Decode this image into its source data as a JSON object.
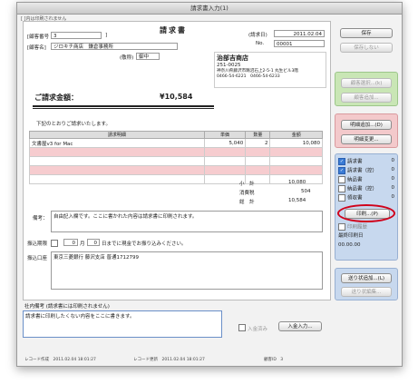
{
  "window": {
    "title": "請求書入力(1)"
  },
  "note_top": "[ ]内は印刷されません",
  "doc": {
    "title": "請求書",
    "customer_no_label": "[顧客番号",
    "customer_no_value": "3",
    "customer_no_suffix": "]",
    "customer_name_label": "[顧客名]",
    "customer_name_value": "ジロキチ商店　鎌倉事務所",
    "honorific_label": "(敬称)",
    "honorific_value": "御中",
    "invoice_date_label": "(請求日)",
    "invoice_date_value": "2011.02.04",
    "no_label": "No.",
    "no_value": "00001",
    "issuer_name": "治部吉商店",
    "issuer_zip": "251-0025",
    "issuer_address": "神奈川県藤沢市鵠沼石上2-5-1 丸生ビル3階",
    "issuer_tel": "0466-54-6221　0466-54-6233",
    "amount_label": "ご請求金額：",
    "amount_value": "¥10,584",
    "intro_text": "下記のとおりご請求いたします。",
    "table_headers": [
      "請求明細",
      "単価",
      "数量",
      "金額"
    ],
    "rows": [
      [
        "文書屋v3 for Mac",
        "5,040",
        "2",
        "10,080"
      ],
      [
        "",
        "",
        "",
        ""
      ],
      [
        "",
        "",
        "",
        ""
      ],
      [
        "",
        "",
        "",
        ""
      ],
      [
        "",
        "",
        "",
        ""
      ]
    ],
    "subtotal_label": "小　計",
    "subtotal_value": "10,080",
    "tax_label": "消費税",
    "tax_value": "504",
    "total_label": "総　計",
    "total_value": "10,584",
    "remarks_label": "備考：",
    "remarks_value": "自由記入欄です。ここに書かれた内容は請求書に印刷されます。",
    "due_label": "振込期限",
    "due_month_value": "0",
    "due_month_label": "月",
    "due_day_value": "0",
    "due_text": "日までに現金でお振り込みください。",
    "bank_label": "振込口座",
    "bank_value": "東京三菱銀行 藤沢支店 普通1712799"
  },
  "internal": {
    "label": "社内備考 (請求書には印刷されません)",
    "value": "請求書に印刷したくない内容をここに書きます。",
    "paid_label": "入金済み",
    "paid_button": "入金入力..."
  },
  "sidebar": {
    "save": "保存",
    "dont_save": "保存しない",
    "customer_select": "顧客選択...(k)",
    "customer_add": "顧客追加...",
    "detail_add": "明細追加...(D)",
    "detail_change": "明細変更...",
    "checks": [
      {
        "label": "請求書",
        "checked": true,
        "count": "0"
      },
      {
        "label": "請求書（控）",
        "checked": true,
        "count": "0"
      },
      {
        "label": "納品書",
        "checked": false,
        "count": "0"
      },
      {
        "label": "納品書（控）",
        "checked": false,
        "count": "0"
      },
      {
        "label": "領収書",
        "checked": false,
        "count": "0"
      }
    ],
    "print": "印刷...(P)",
    "print_hist": "印刷履歴",
    "last_print_label": "最終印刷日",
    "last_print_value": "00.00.00",
    "delivery_add": "送り状追加...(L)",
    "delivery_edit": "送り状編集..."
  },
  "status": {
    "created": "レコード作成　2011.02.04 18:01:27",
    "updated": "レコード更新　2011.02.04 18:01:27",
    "id": "顧客ID　3"
  },
  "colors": {
    "pink": "#f6cccf",
    "green": "#c9e6b5",
    "red_group": "#f3c9cb",
    "blue_group": "#c7d8ee",
    "highlight": "#d0021b"
  }
}
